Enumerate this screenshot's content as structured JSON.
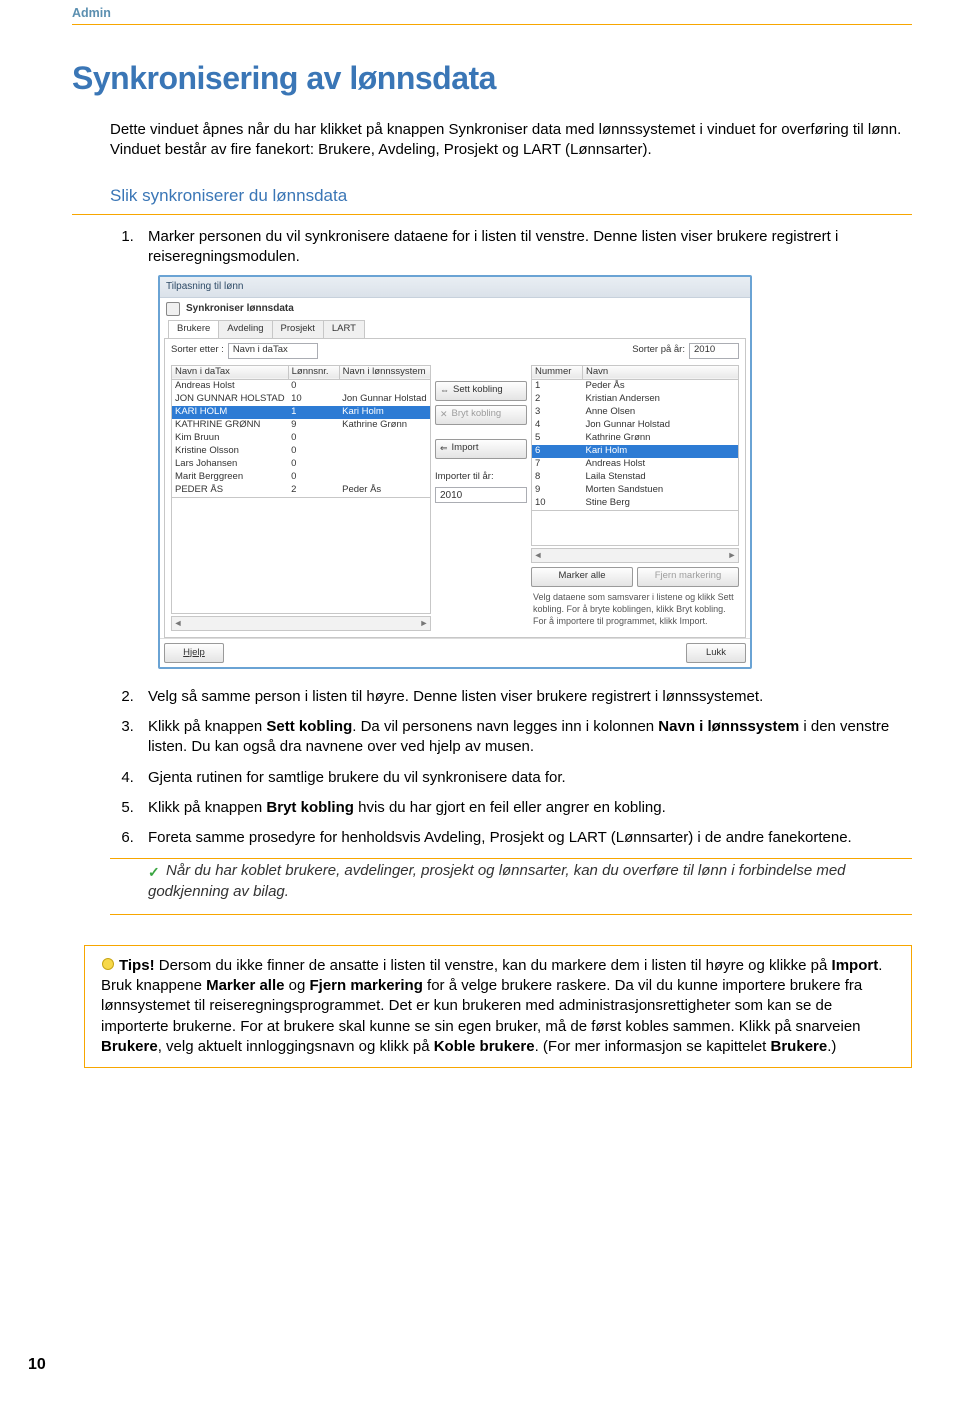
{
  "header": {
    "section": "Admin"
  },
  "title": "Synkronisering av lønnsdata",
  "intro": "Dette vinduet åpnes når du har klikket på knappen Synkroniser data med lønnssystemet i vinduet for overføring til lønn. Vinduet består av fire fanekort: Brukere, Avdeling, Prosjekt og LART (Lønnsarter).",
  "subheading": "Slik synkroniserer du lønnsdata",
  "step1": "Marker personen du vil synkronisere dataene for i listen til venstre. Denne listen viser brukere registrert i reiseregningsmodulen.",
  "screenshot": {
    "window_title": "Tilpasning til lønn",
    "sync_label": "Synkroniser lønnsdata",
    "tabs": [
      "Brukere",
      "Avdeling",
      "Prosjekt",
      "LART"
    ],
    "sort_by_label": "Sorter etter :",
    "sort_by_value": "Navn i daTax",
    "sort_year_label": "Sorter på år:",
    "sort_year_value": "2010",
    "left_headers": [
      "Navn i daTax",
      "Lønnsnr.",
      "Navn i lønnssystem"
    ],
    "left_rows": [
      {
        "name": "Andreas Holst",
        "nr": "0",
        "payroll": ""
      },
      {
        "name": "JON GUNNAR HOLSTAD",
        "nr": "10",
        "payroll": "Jon Gunnar Holstad"
      },
      {
        "name": "KARI HOLM",
        "nr": "1",
        "payroll": "Kari Holm",
        "selected": true
      },
      {
        "name": "KATHRINE GRØNN",
        "nr": "9",
        "payroll": "Kathrine Grønn"
      },
      {
        "name": "Kim Bruun",
        "nr": "0",
        "payroll": ""
      },
      {
        "name": "Kristine Olsson",
        "nr": "0",
        "payroll": ""
      },
      {
        "name": "Lars Johansen",
        "nr": "0",
        "payroll": ""
      },
      {
        "name": "Marit Berggreen",
        "nr": "0",
        "payroll": ""
      },
      {
        "name": "PEDER ÅS",
        "nr": "2",
        "payroll": "Peder Ås"
      }
    ],
    "btn_set": "Sett kobling",
    "btn_break": "Bryt kobling",
    "btn_import": "Import",
    "import_year_label": "Importer til år:",
    "import_year_value": "2010",
    "right_headers": [
      "Nummer",
      "Navn"
    ],
    "right_rows": [
      {
        "num": "1",
        "name": "Peder Ås"
      },
      {
        "num": "2",
        "name": "Kristian Andersen"
      },
      {
        "num": "3",
        "name": "Anne Olsen"
      },
      {
        "num": "4",
        "name": "Jon Gunnar Holstad"
      },
      {
        "num": "5",
        "name": "Kathrine Grønn"
      },
      {
        "num": "6",
        "name": "Kari Holm",
        "selected": true
      },
      {
        "num": "7",
        "name": "Andreas Holst"
      },
      {
        "num": "8",
        "name": "Laila Stenstad"
      },
      {
        "num": "9",
        "name": "Morten Sandstuen"
      },
      {
        "num": "10",
        "name": "Stine Berg"
      }
    ],
    "btn_mark_all": "Marker alle",
    "btn_clear": "Fjern markering",
    "hint_text": "Velg dataene som samsvarer i listene og klikk Sett kobling. For å bryte koblingen, klikk Bryt kobling. For å importere til programmet, klikk Import.",
    "btn_help": "Hjelp",
    "btn_close": "Lukk"
  },
  "step2": "Velg så samme person i listen til høyre. Denne listen viser brukere registrert i lønnssystemet.",
  "step3_a": "Klikk på knappen ",
  "step3_bold1": "Sett kobling",
  "step3_b": ". Da vil personens navn legges inn i kolonnen ",
  "step3_bold2": "Navn i lønnssystem",
  "step3_c": " i den venstre listen. Du kan også dra navnene over ved hjelp av musen.",
  "step4": "Gjenta rutinen for samtlige brukere du vil synkronisere data for.",
  "step5_a": "Klikk på knappen ",
  "step5_bold": "Bryt kobling",
  "step5_b": " hvis du har gjort en feil eller angrer en kobling.",
  "step6": "Foreta samme prosedyre for henholdsvis Avdeling, Prosjekt og LART (Lønnsarter) i de andre fanekortene.",
  "note": "Når du har koblet brukere, avdelinger, prosjekt og lønnsarter, kan du overføre til lønn i forbindelse med godkjenning av bilag.",
  "tip_label": "Tips!",
  "tip_1": " Dersom du ikke finner de ansatte i listen til venstre, kan du markere dem i listen til høyre og klikke på ",
  "tip_bold1": "Import",
  "tip_2": ". Bruk knappene ",
  "tip_bold2": "Marker alle",
  "tip_3": " og ",
  "tip_bold3": "Fjern markering",
  "tip_4": " for å velge brukere raskere. Da vil du kunne importere brukere fra lønnsystemet til reiseregnings­programmet. Det er kun brukeren med administrasjonsrettigheter som kan se de importerte brukerne. For at brukere skal kunne se sin egen bruker, må de først kobles sammen. Klikk på snarveien ",
  "tip_bold4": "Brukere",
  "tip_5": ", velg aktuelt innloggingsnavn og klikk på ",
  "tip_bold5": "Koble brukere",
  "tip_6": ". (For mer informasjon se kapittelet ",
  "tip_bold6": "Brukere",
  "tip_7": ".)",
  "page_number": "10"
}
